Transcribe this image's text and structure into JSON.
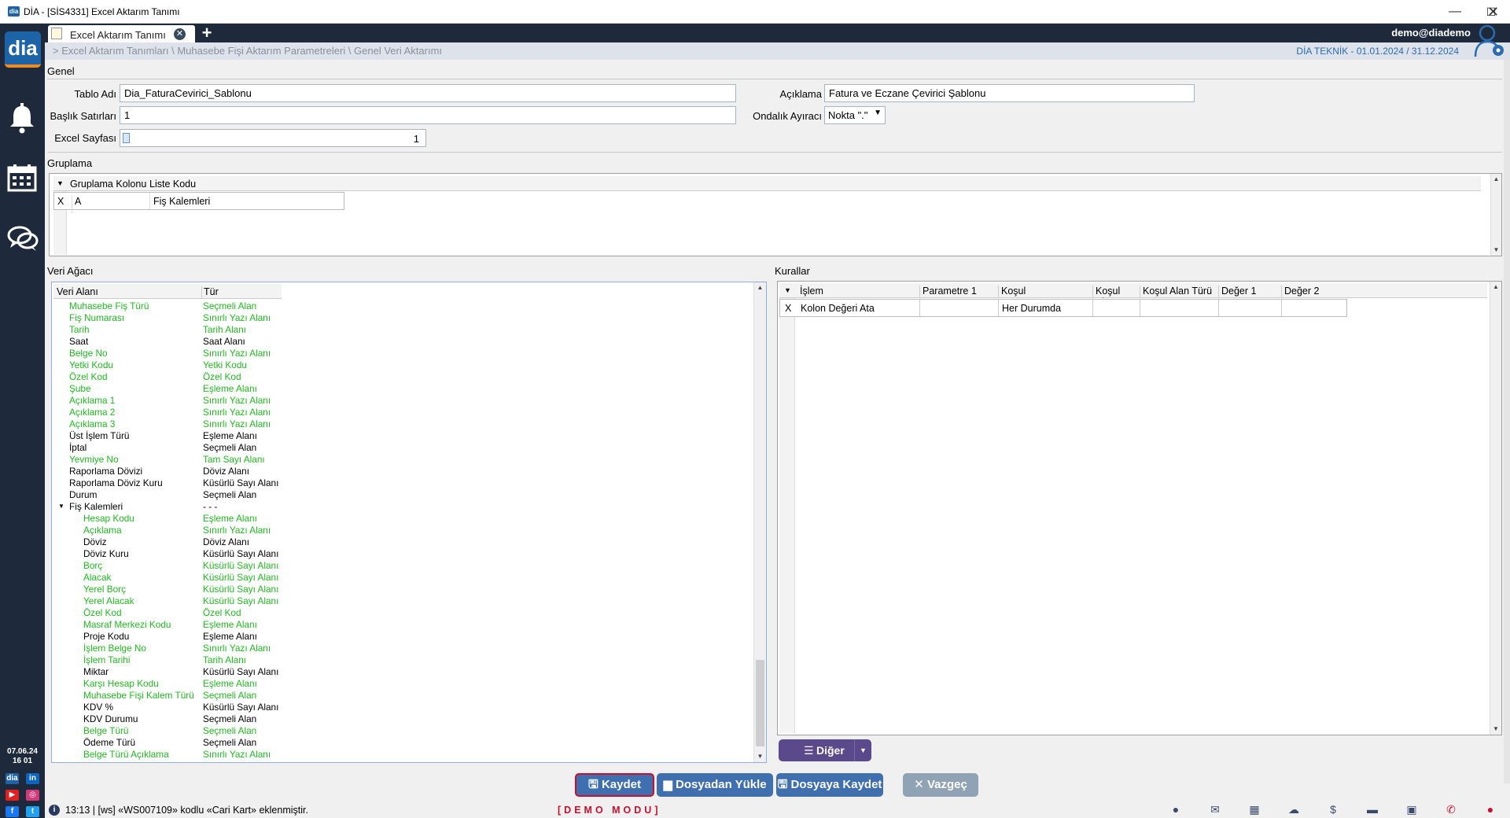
{
  "window": {
    "title": "DİA - [SİS4331] Excel Aktarım Tanımı",
    "app_icon": "dia"
  },
  "sidebar": {
    "logo": "dia",
    "icons": [
      "bell-icon",
      "calendar-icon",
      "chat-icon"
    ],
    "date": "07.06.24",
    "time": "16 01",
    "social": {
      "dia": "dia",
      "linkedin": "in",
      "youtube": "▶",
      "instagram": "◎",
      "facebook": "f",
      "twitter": "t"
    }
  },
  "tabs": [
    {
      "label": "Excel Aktarım Tanımı"
    }
  ],
  "user": "demo@diademo",
  "breadcrumb": "> Excel Aktarım Tanımları \\ Muhasebe Fişi Aktarım Parametreleri \\ Genel Veri Aktarımı",
  "period": "DİA TEKNİK -  01.01.2024 / 31.12.2024",
  "genel": {
    "title": "Genel",
    "tablo_adi_label": "Tablo Adı",
    "tablo_adi": "Dia_FaturaCevirici_Sablonu",
    "baslik_label": "Başlık Satırları",
    "baslik": "1",
    "excel_label": "Excel Sayfası",
    "excel": "1",
    "aciklama_label": "Açıklama",
    "aciklama": "Fatura ve Eczane Çevirici Şablonu",
    "ondalik_label": "Ondalık Ayıracı",
    "ondalik": "Nokta \".\""
  },
  "gruplama": {
    "title": "Gruplama",
    "columns": [
      "Gruplama Kolonu",
      "Liste Kodu"
    ],
    "rows": [
      {
        "x": "X",
        "kolon": "A",
        "liste": "Fiş Kalemleri"
      }
    ]
  },
  "veri_agaci": {
    "title": "Veri Ağacı",
    "columns": [
      "Veri Alanı",
      "Tür"
    ],
    "rows": [
      {
        "name": "Muhasebe Fiş Türü",
        "type": "Seçmeli Alan",
        "green": true,
        "level": 0
      },
      {
        "name": "Fiş Numarası",
        "type": "Sınırlı Yazı Alanı",
        "green": true,
        "level": 0
      },
      {
        "name": "Tarih",
        "type": "Tarih Alanı",
        "green": true,
        "level": 0
      },
      {
        "name": "Saat",
        "type": "Saat Alanı",
        "green": false,
        "level": 0
      },
      {
        "name": "Belge No",
        "type": "Sınırlı Yazı Alanı",
        "green": true,
        "level": 0
      },
      {
        "name": "Yetki Kodu",
        "type": "Yetki Kodu",
        "green": true,
        "level": 0
      },
      {
        "name": "Özel Kod",
        "type": "Özel Kod",
        "green": true,
        "level": 0
      },
      {
        "name": "Şube",
        "type": "Eşleme Alanı",
        "green": true,
        "level": 0
      },
      {
        "name": "Açıklama 1",
        "type": "Sınırlı Yazı Alanı",
        "green": true,
        "level": 0
      },
      {
        "name": "Açıklama 2",
        "type": "Sınırlı Yazı Alanı",
        "green": true,
        "level": 0
      },
      {
        "name": "Açıklama 3",
        "type": "Sınırlı Yazı Alanı",
        "green": true,
        "level": 0
      },
      {
        "name": "Üst İşlem Türü",
        "type": "Eşleme Alanı",
        "green": false,
        "level": 0
      },
      {
        "name": "İptal",
        "type": "Seçmeli Alan",
        "green": false,
        "level": 0
      },
      {
        "name": "Yevmiye No",
        "type": "Tam Sayı Alanı",
        "green": true,
        "level": 0
      },
      {
        "name": "Raporlama Dövizi",
        "type": "Döviz Alanı",
        "green": false,
        "level": 0
      },
      {
        "name": "Raporlama Döviz Kuru",
        "type": "Küsürlü Sayı Alanı",
        "green": false,
        "level": 0
      },
      {
        "name": "Durum",
        "type": "Seçmeli Alan",
        "green": false,
        "level": 0
      },
      {
        "name": "Fiş Kalemleri",
        "type": "- - -",
        "green": false,
        "level": 0,
        "expander": true
      },
      {
        "name": "Hesap Kodu",
        "type": "Eşleme Alanı",
        "green": true,
        "level": 1
      },
      {
        "name": "Açıklama",
        "type": "Sınırlı Yazı Alanı",
        "green": true,
        "level": 1
      },
      {
        "name": "Döviz",
        "type": "Döviz Alanı",
        "green": false,
        "level": 1
      },
      {
        "name": "Döviz Kuru",
        "type": "Küsürlü Sayı Alanı",
        "green": false,
        "level": 1
      },
      {
        "name": "Borç",
        "type": "Küsürlü Sayı Alanı",
        "green": true,
        "level": 1
      },
      {
        "name": "Alacak",
        "type": "Küsürlü Sayı Alanı",
        "green": true,
        "level": 1
      },
      {
        "name": "Yerel Borç",
        "type": "Küsürlü Sayı Alanı",
        "green": true,
        "level": 1
      },
      {
        "name": "Yerel Alacak",
        "type": "Küsürlü Sayı Alanı",
        "green": true,
        "level": 1
      },
      {
        "name": "Özel Kod",
        "type": "Özel Kod",
        "green": true,
        "level": 1
      },
      {
        "name": "Masraf Merkezi Kodu",
        "type": "Eşleme Alanı",
        "green": true,
        "level": 1
      },
      {
        "name": "Proje Kodu",
        "type": "Eşleme Alanı",
        "green": false,
        "level": 1
      },
      {
        "name": "İşlem Belge No",
        "type": "Sınırlı Yazı Alanı",
        "green": true,
        "level": 1
      },
      {
        "name": "İşlem Tarihi",
        "type": "Tarih Alanı",
        "green": true,
        "level": 1
      },
      {
        "name": "Miktar",
        "type": "Küsürlü Sayı Alanı",
        "green": false,
        "level": 1
      },
      {
        "name": "Karşı Hesap Kodu",
        "type": "Eşleme Alanı",
        "green": true,
        "level": 1
      },
      {
        "name": "Muhasebe Fişi Kalem Türü",
        "type": "Seçmeli Alan",
        "green": true,
        "level": 1
      },
      {
        "name": "KDV %",
        "type": "Küsürlü Sayı Alanı",
        "green": false,
        "level": 1
      },
      {
        "name": "KDV Durumu",
        "type": "Seçmeli Alan",
        "green": false,
        "level": 1
      },
      {
        "name": "Belge Türü",
        "type": "Seçmeli Alan",
        "green": true,
        "level": 1
      },
      {
        "name": "Ödeme Türü",
        "type": "Seçmeli Alan",
        "green": false,
        "level": 1
      },
      {
        "name": "Belge Türü Açıklama",
        "type": "Sınırlı Yazı Alanı",
        "green": true,
        "level": 1
      }
    ]
  },
  "kurallar": {
    "title": "Kurallar",
    "columns": [
      "İşlem",
      "Parametre 1",
      "Koşul",
      "Koşul Alan",
      "Koşul Alan Türü",
      "Değer 1",
      "Değer 2"
    ],
    "rows": [
      {
        "x": "X",
        "islem": "Kolon Değeri Ata",
        "param1": "",
        "kosul": "Her Durumda",
        "kosul_alan": "",
        "kosul_alan_turu": "",
        "deger1": "",
        "deger2": ""
      }
    ],
    "diger_button": "Diğer"
  },
  "buttons": {
    "kaydet": "Kaydet",
    "dosyadan_yukle": "Dosyadan Yükle",
    "dosyaya_kaydet": "Dosyaya Kaydet",
    "vazgec": "Vazgeç"
  },
  "status": {
    "message": "13:13  |  [ws] «WS007109» kodlu «Cari Kart» eklenmiştir.",
    "demo": "[DEMO  MODU]"
  },
  "colors": {
    "green": "#22b822",
    "sidebar": "#1e2a3c",
    "accent": "#3f6fae",
    "demo": "#c8102e"
  }
}
